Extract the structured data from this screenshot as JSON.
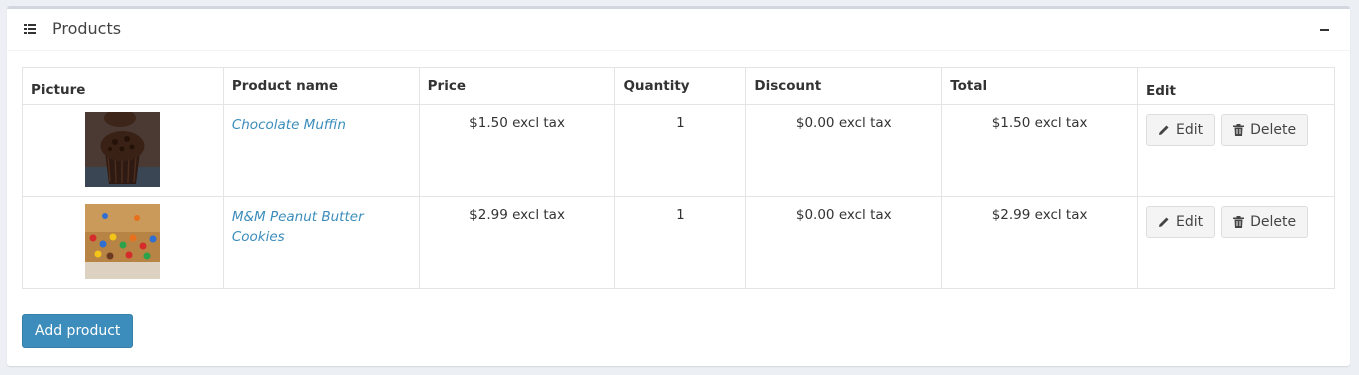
{
  "panel": {
    "title": "Products",
    "title_icon": "list-icon",
    "collapse_icon": "minus-icon"
  },
  "table": {
    "headers": [
      "Picture",
      "Product name",
      "Price",
      "Quantity",
      "Discount",
      "Total",
      "Edit"
    ],
    "rows": [
      {
        "picture": "chocolate-muffin-image",
        "name": "Chocolate Muffin",
        "price": "$1.50 excl tax",
        "quantity": "1",
        "discount": "$0.00 excl tax",
        "total": "$1.50 excl tax",
        "edit_label": "Edit",
        "delete_label": "Delete"
      },
      {
        "picture": "mm-peanut-butter-cookies-image",
        "name": "M&M Peanut Butter Cookies",
        "price": "$2.99 excl tax",
        "quantity": "1",
        "discount": "$0.00 excl tax",
        "total": "$2.99 excl tax",
        "edit_label": "Edit",
        "delete_label": "Delete"
      }
    ]
  },
  "actions": {
    "add_product_label": "Add product"
  },
  "colors": {
    "primary": "#3c8dbc",
    "link": "#3c8dbc",
    "button_bg": "#f4f4f4"
  }
}
